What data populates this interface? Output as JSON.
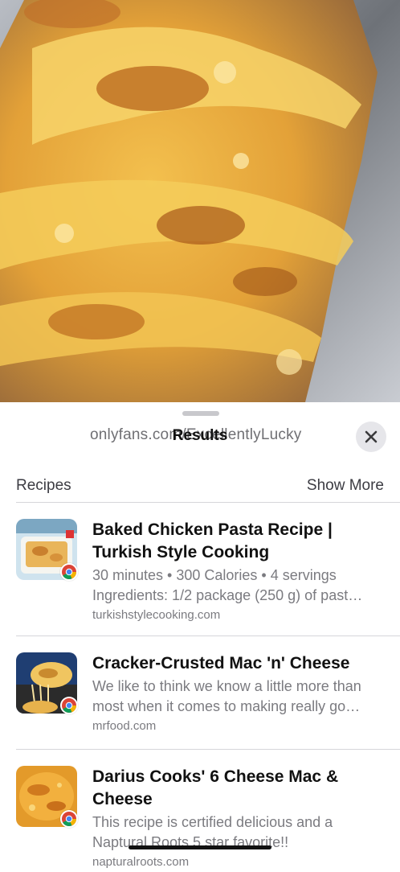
{
  "header": {
    "watermark": "onlyfans.com/ExcellentlyLucky",
    "title": "Results"
  },
  "section": {
    "label": "Recipes",
    "show_more": "Show More"
  },
  "results": [
    {
      "title": "Baked Chicken Pasta Recipe | Turkish Style Cooking",
      "meta": "30 minutes • 300 Calories • 4 servings",
      "desc": "Ingredients: 1/2 package (250 g) of past…",
      "source": "turkishstylecooking.com"
    },
    {
      "title": "Cracker-Crusted Mac 'n' Cheese",
      "meta": "We like to think we know a little more than",
      "desc": "most when it comes to making really go…",
      "source": "mrfood.com"
    },
    {
      "title": "Darius Cooks' 6 Cheese Mac & Cheese",
      "meta": "This recipe is certified delicious and a",
      "desc": "Naptural Roots 5 star favorite!!",
      "source": "napturalroots.com"
    }
  ],
  "icons": {
    "close": "close-icon",
    "browser": "chrome-icon"
  },
  "colors": {
    "cheese": "#E8A93A",
    "crust": "#B8651C",
    "foil": "#8E8E93"
  }
}
